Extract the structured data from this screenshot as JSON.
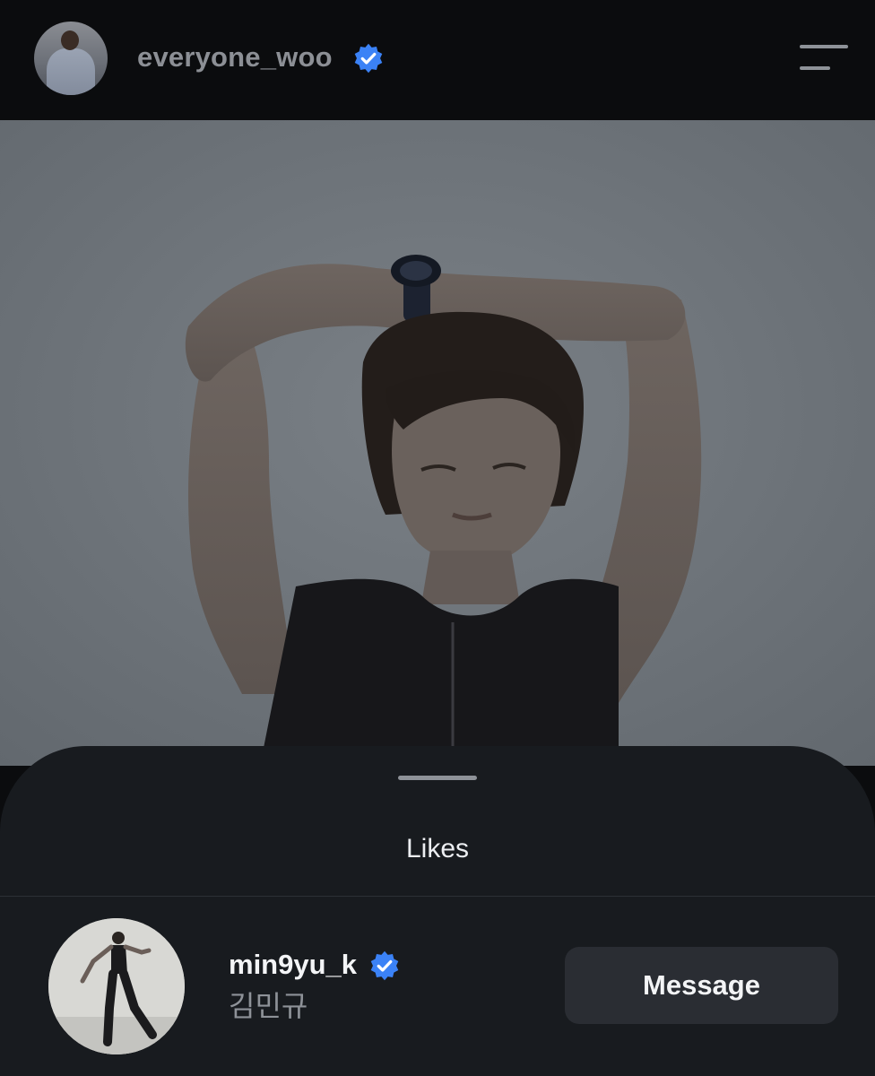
{
  "header": {
    "username": "everyone_woo",
    "verified_icon": "verified-badge-icon",
    "menu_icon": "menu-icon",
    "avatar_alt": "profile avatar"
  },
  "colors": {
    "verified_blue": "#3b82f6",
    "sheet_background": "#181b1f",
    "button_background": "#2a2d33"
  },
  "sheet": {
    "title": "Likes"
  },
  "likes": [
    {
      "username": "min9yu_k",
      "full_name": "김민규",
      "verified": true,
      "button_label": "Message"
    }
  ]
}
